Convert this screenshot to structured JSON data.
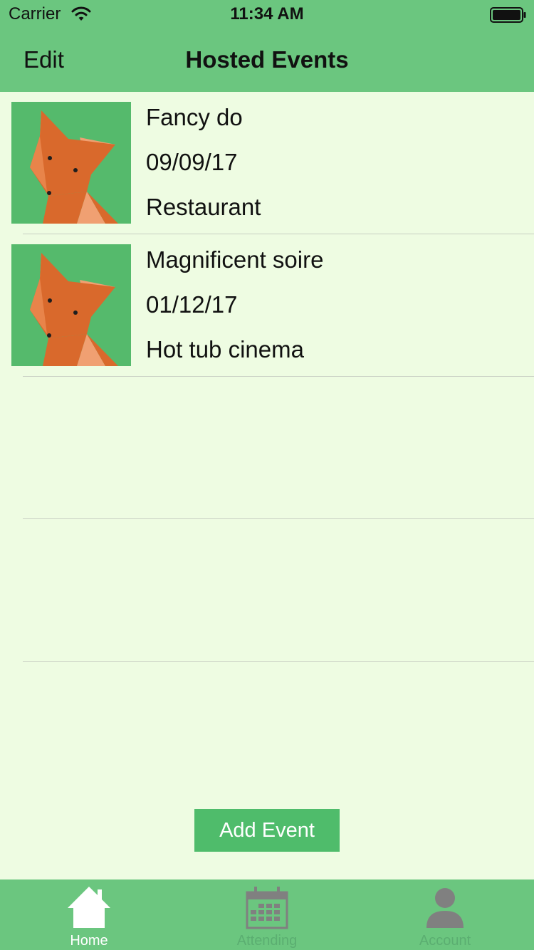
{
  "status_bar": {
    "carrier": "Carrier",
    "time": "11:34 AM"
  },
  "nav": {
    "edit_label": "Edit",
    "title": "Hosted Events"
  },
  "events": [
    {
      "name": "Fancy do",
      "date": "09/09/17",
      "venue": "Restaurant"
    },
    {
      "name": "Magnificent soire",
      "date": "01/12/17",
      "venue": "Hot tub cinema"
    }
  ],
  "add_button_label": "Add Event",
  "tabs": [
    {
      "label": "Home",
      "icon": "home-icon",
      "selected": true
    },
    {
      "label": "Attending",
      "icon": "calendar-icon",
      "selected": false
    },
    {
      "label": "Account",
      "icon": "person-icon",
      "selected": false
    }
  ],
  "colors": {
    "bar_green": "#6BC67F",
    "background": "#EEFCE2",
    "button_green": "#4FBC6B",
    "fox_orange": "#D9692C",
    "tab_selected": "#FFFFFF",
    "tab_unselected": "#808080"
  }
}
